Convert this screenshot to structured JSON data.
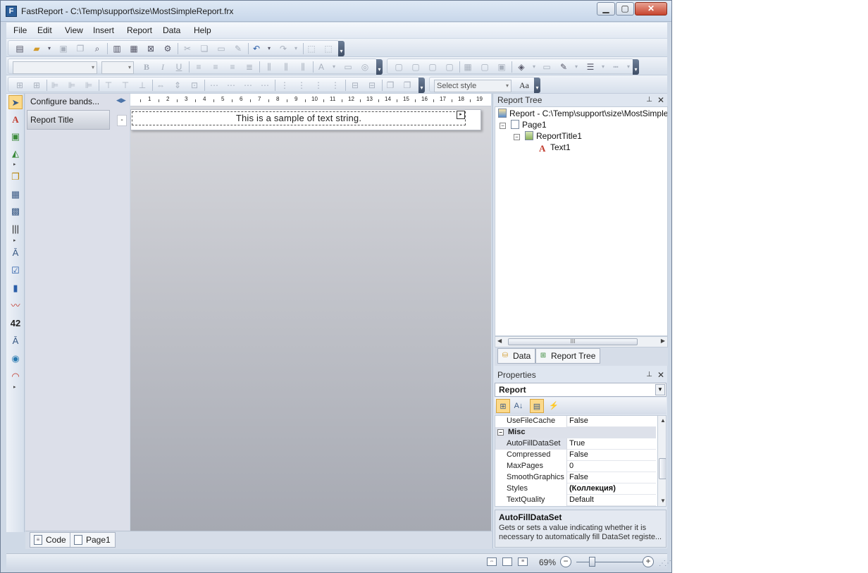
{
  "window": {
    "title": "FastReport - C:\\Temp\\support\\size\\MostSimpleReport.frx",
    "app_icon": "fastreport-app-icon",
    "minimize": "▁",
    "maximize": "▢",
    "close": "✕"
  },
  "menu": [
    "File",
    "Edit",
    "View",
    "Insert",
    "Report",
    "Data",
    "Help"
  ],
  "toolbar": {
    "style_placeholder": "Select style",
    "style_editor_icon": "Aa"
  },
  "bands": {
    "configure_label": "Configure bands...",
    "report_title_band": "Report Title",
    "collapse_glyph": "-"
  },
  "ruler": {
    "marks": [
      "1",
      "2",
      "3",
      "4",
      "5",
      "6",
      "7",
      "8",
      "9",
      "10",
      "11",
      "12",
      "13",
      "14",
      "15",
      "16",
      "17",
      "18",
      "19"
    ]
  },
  "canvas": {
    "text1_content": "This is a sample of text string."
  },
  "page_tabs": {
    "code": "Code",
    "page1": "Page1"
  },
  "report_tree": {
    "header": "Report Tree",
    "nodes": {
      "report": "Report - C:\\Temp\\support\\size\\MostSimpleReport.frx",
      "page1": "Page1",
      "report_title1": "ReportTitle1",
      "text1": "Text1"
    },
    "scroll_grip": "III"
  },
  "panel_tabs": {
    "data": "Data",
    "report_tree": "Report Tree"
  },
  "properties": {
    "header": "Properties",
    "selected_object": "Report",
    "rows_top": [
      {
        "name": "UseFileCache",
        "value": "False"
      }
    ],
    "category": "Misc",
    "rows": [
      {
        "name": "AutoFillDataSet",
        "value": "True"
      },
      {
        "name": "Compressed",
        "value": "False"
      },
      {
        "name": "MaxPages",
        "value": "0"
      },
      {
        "name": "SmoothGraphics",
        "value": "False"
      },
      {
        "name": "Styles",
        "value": "(Коллекция)"
      },
      {
        "name": "TextQuality",
        "value": "Default"
      }
    ],
    "description_title": "AutoFillDataSet",
    "description_text": "Gets or sets a value indicating whether it is necessary to automatically fill DataSet registe..."
  },
  "status": {
    "zoom": "69%",
    "zoom_level_percent": 69
  },
  "colors": {
    "accent_selected": "#fbd98a",
    "title_bar": "#dfe9f5",
    "close_button": "#c7442e"
  }
}
